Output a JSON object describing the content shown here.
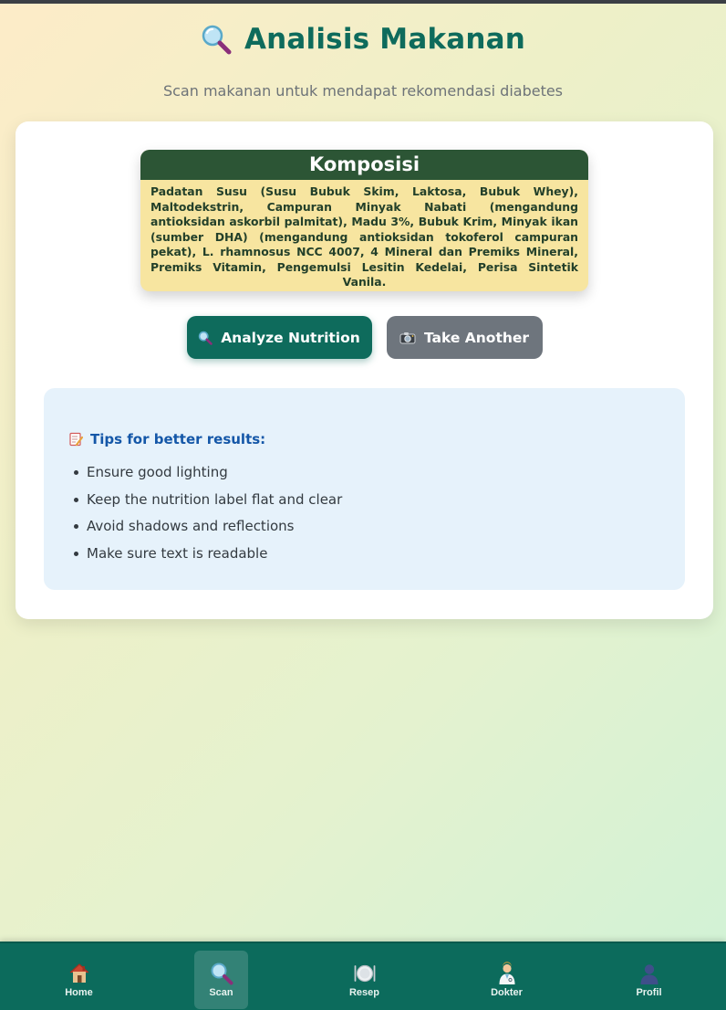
{
  "header": {
    "title": "Analisis Makanan",
    "title_icon": "magnifier-icon",
    "subtitle": "Scan makanan untuk mendapat rekomendasi diabetes"
  },
  "scan_image": {
    "heading": "Komposisi",
    "text": "Padatan Susu (Susu Bubuk Skim, Laktosa, Bubuk Whey), Maltodekstrin, Campuran Minyak Nabati (mengandung antioksidan askorbil palmitat), Madu 3%, Bubuk Krim, Minyak ikan (sumber DHA) (mengandung antioksidan tokoferol campuran pekat), L. rhamnosus NCC 4007, 4 Mineral dan Premiks Mineral, Premiks Vitamin, Pengemulsi Lesitin Kedelai, Perisa Sintetik Vanila."
  },
  "actions": {
    "analyze_label": "Analyze Nutrition",
    "analyze_icon": "magnifier-icon",
    "retake_label": "Take Another",
    "retake_icon": "camera-icon"
  },
  "tips": {
    "title": "Tips for better results:",
    "title_icon": "memo-icon",
    "items": [
      "Ensure good lighting",
      "Keep the nutrition label flat and clear",
      "Avoid shadows and reflections",
      "Make sure text is readable"
    ]
  },
  "nav": {
    "items": [
      {
        "label": "Home",
        "icon": "house-icon",
        "active": false
      },
      {
        "label": "Scan",
        "icon": "magnifier-icon",
        "active": true
      },
      {
        "label": "Resep",
        "icon": "plate-icon",
        "active": false
      },
      {
        "label": "Dokter",
        "icon": "doctor-icon",
        "active": false
      },
      {
        "label": "Profil",
        "icon": "user-icon",
        "active": false
      }
    ]
  },
  "colors": {
    "primary": "#0e6b5c",
    "secondary_button": "#6e757d",
    "tips_background": "#e6f2fb",
    "tips_title": "#1457a8",
    "label_header": "#2c5535",
    "label_body": "#f7e5a0"
  }
}
